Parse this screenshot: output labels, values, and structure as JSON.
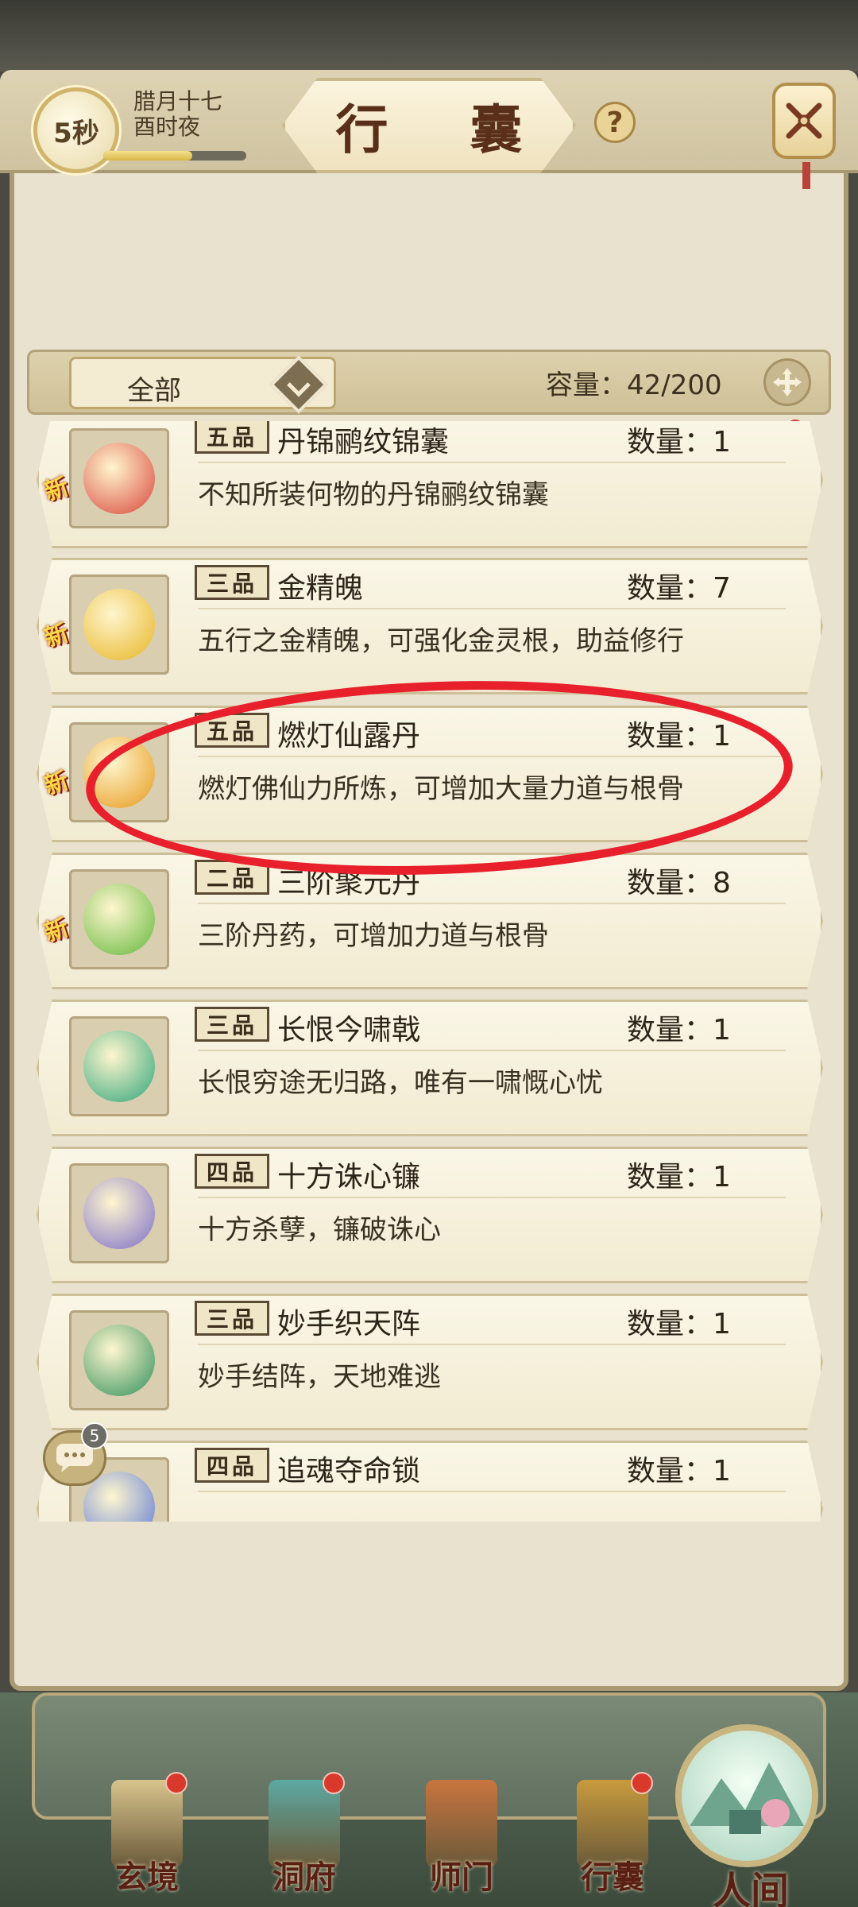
{
  "header": {
    "timer": "5秒",
    "date_line1": "腊月十七",
    "date_line2": "酉时夜",
    "progress": 0.62,
    "title": "行 囊",
    "help_label": "?"
  },
  "filter": {
    "selected": "全部",
    "capacity": "容量：42/200"
  },
  "items": [
    {
      "grade": "五品",
      "name": "丹锦鹂纹锦囊",
      "qty": "数量：1",
      "desc": "不知所装何物的丹锦鹂纹锦囊",
      "is_new": true,
      "new_label": "新",
      "color": "#d9463a"
    },
    {
      "grade": "三品",
      "name": "金精魄",
      "qty": "数量：7",
      "desc": "五行之金精魄，可强化金灵根，助益修行",
      "is_new": true,
      "new_label": "新",
      "color": "#e7b524"
    },
    {
      "grade": "五品",
      "name": "燃灯仙露丹",
      "qty": "数量：1",
      "desc": "燃灯佛仙力所炼，可增加大量力道与根骨",
      "is_new": true,
      "new_label": "新",
      "color": "#e69a1c"
    },
    {
      "grade": "二品",
      "name": "三阶聚元丹",
      "qty": "数量：8",
      "desc": "三阶丹药，可增加力道与根骨",
      "is_new": true,
      "new_label": "新",
      "color": "#63b83a"
    },
    {
      "grade": "三品",
      "name": "长恨今啸戟",
      "qty": "数量：1",
      "desc": "长恨穷途无归路，唯有一啸慨心忧",
      "is_new": false,
      "new_label": "",
      "color": "#2fa57a"
    },
    {
      "grade": "四品",
      "name": "十方诛心镰",
      "qty": "数量：1",
      "desc": "十方杀孽，镰破诛心",
      "is_new": false,
      "new_label": "",
      "color": "#7b6ec8"
    },
    {
      "grade": "三品",
      "name": "妙手织天阵",
      "qty": "数量：1",
      "desc": "妙手结阵，天地难逃",
      "is_new": false,
      "new_label": "",
      "color": "#2f8f5a"
    },
    {
      "grade": "四品",
      "name": "追魂夺命锁",
      "qty": "数量：1",
      "desc": "",
      "is_new": false,
      "new_label": "",
      "color": "#5a78d6"
    }
  ],
  "chat": {
    "badge": "5"
  },
  "nav": [
    {
      "label": "玄境",
      "has_dot": true,
      "color": "#d9c48d"
    },
    {
      "label": "洞府",
      "has_dot": true,
      "color": "#5ca9a2"
    },
    {
      "label": "师门",
      "has_dot": false,
      "color": "#c8743f"
    },
    {
      "label": "行囊",
      "has_dot": true,
      "color": "#c89b3d"
    }
  ],
  "human": {
    "label": "人间"
  }
}
